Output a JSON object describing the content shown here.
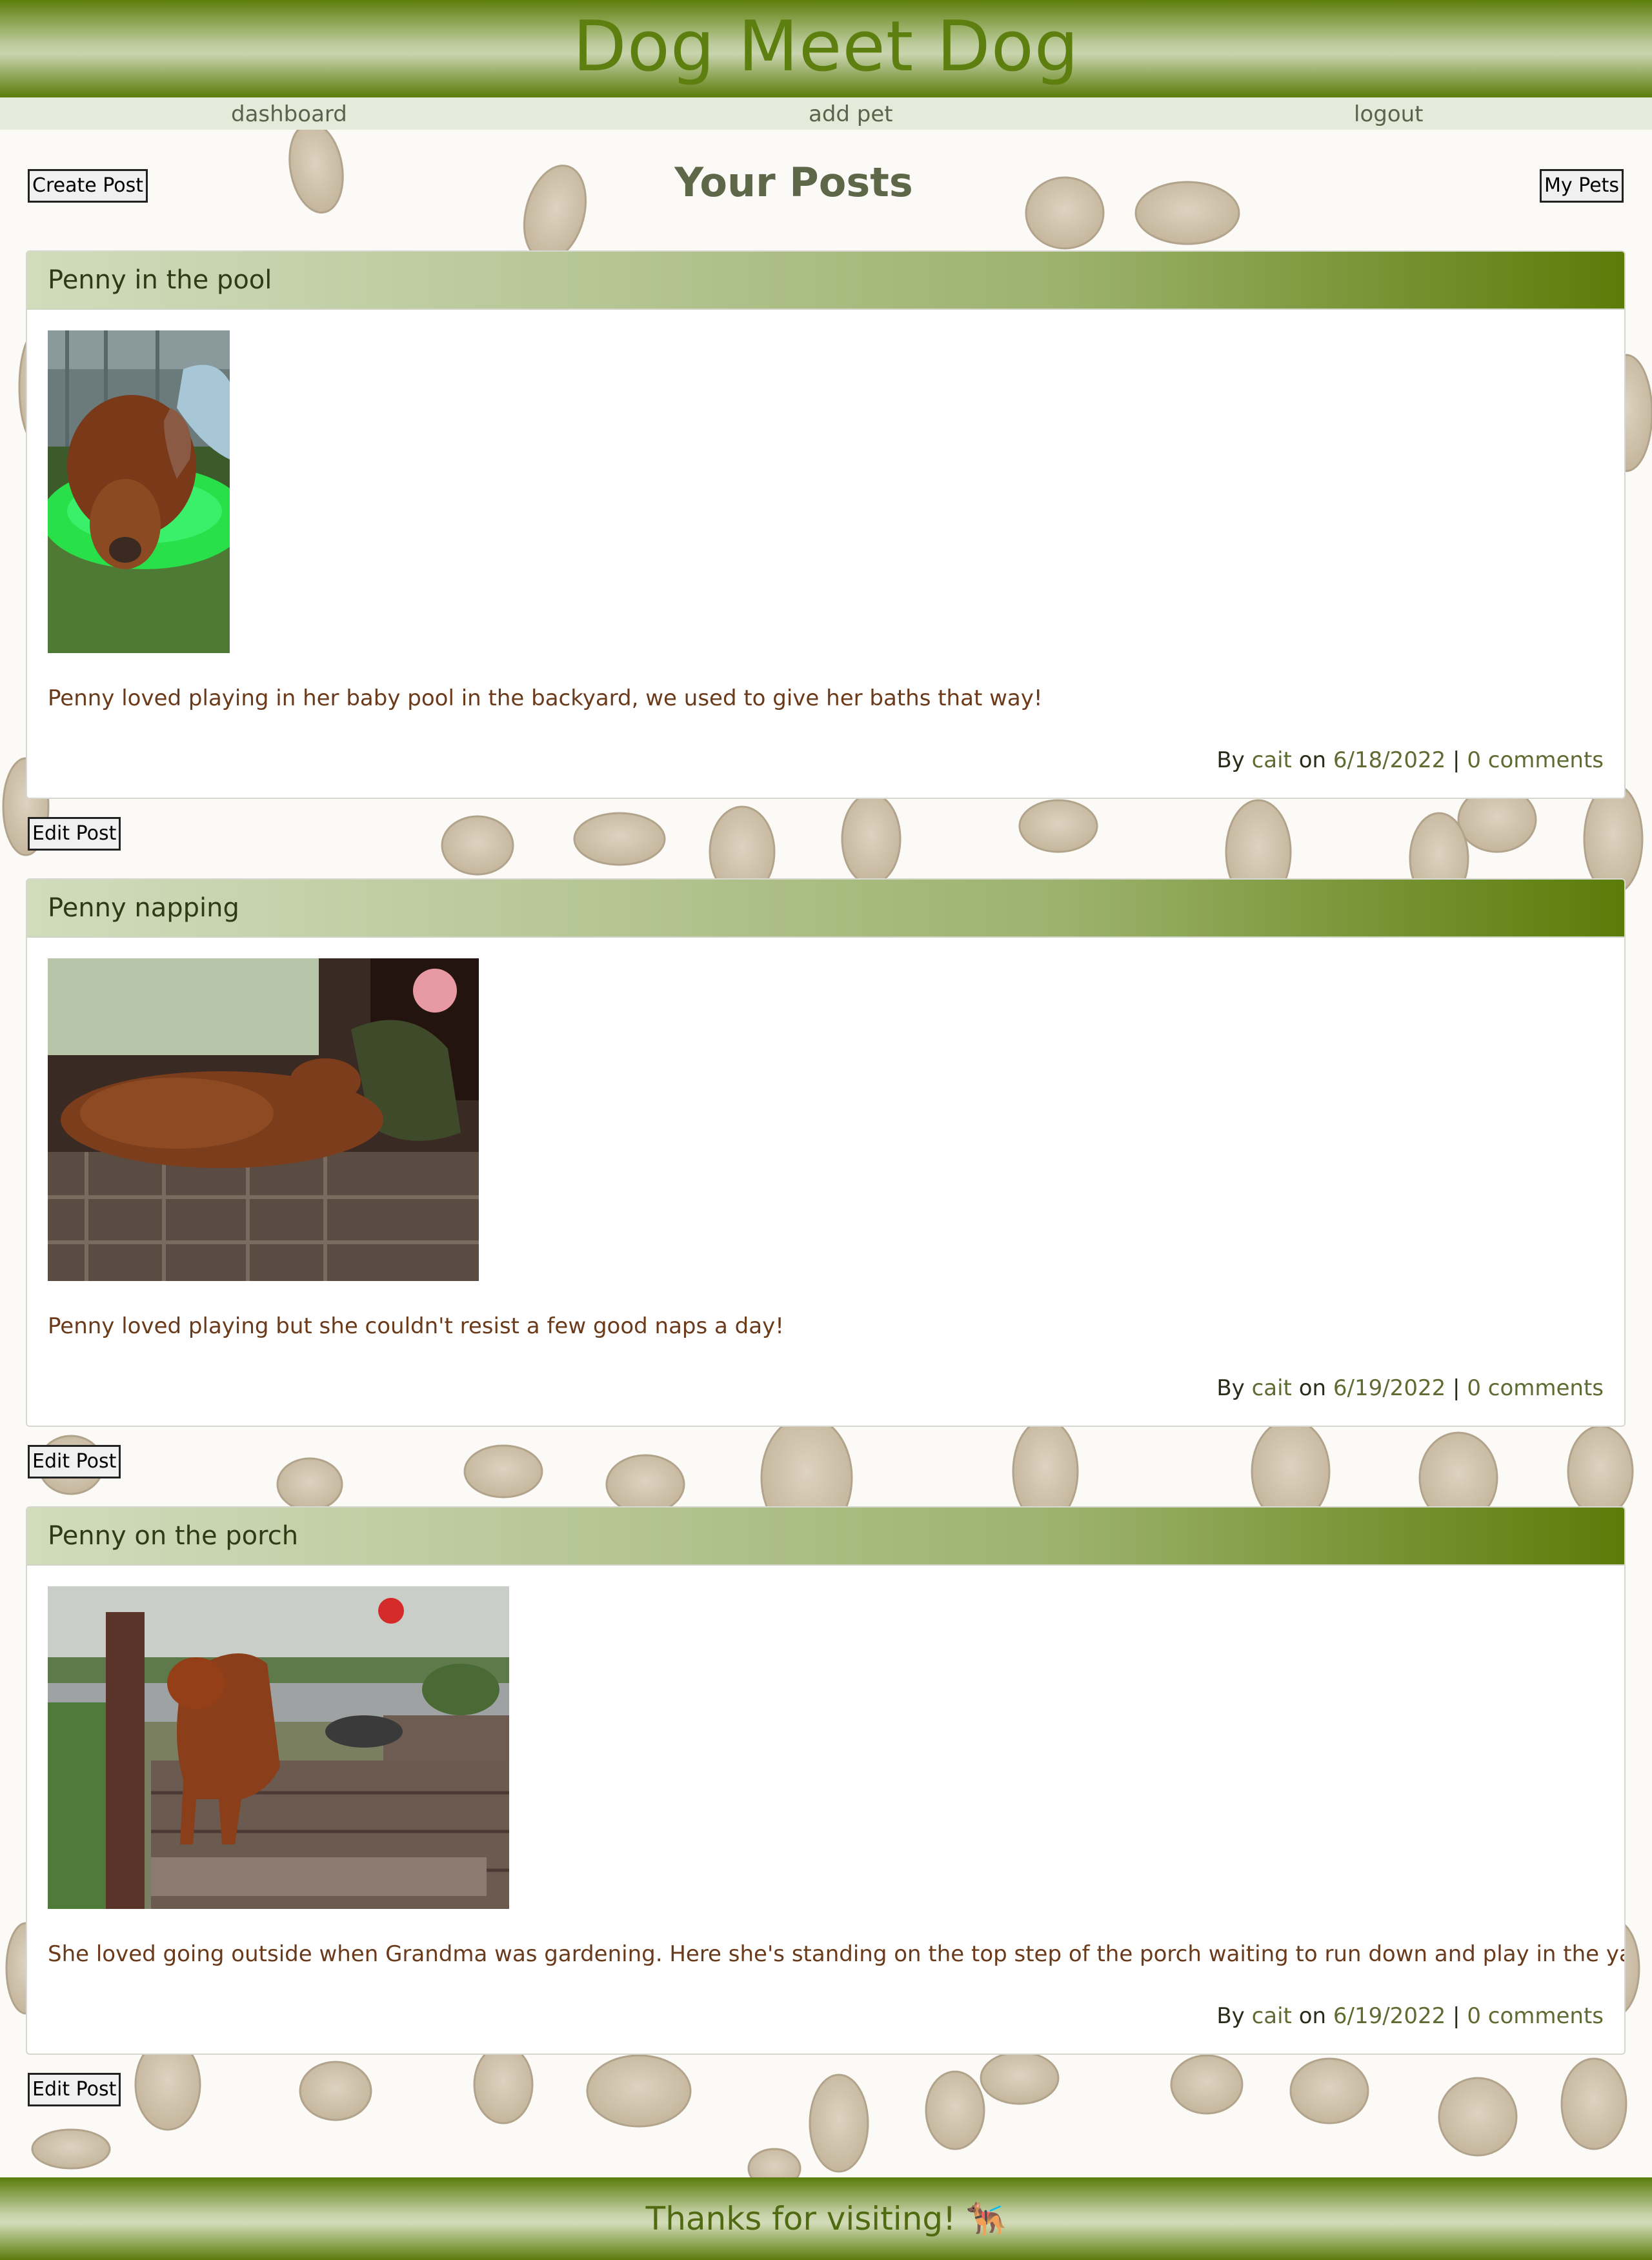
{
  "site": {
    "title": "Dog Meet Dog"
  },
  "nav": {
    "dashboard": "dashboard",
    "add_pet": "add pet",
    "logout": "logout"
  },
  "toolbar": {
    "create_post": "Create Post",
    "page_title": "Your Posts",
    "my_pets": "My Pets"
  },
  "posts": [
    {
      "title": "Penny in the pool",
      "caption": "Penny loved playing in her baby pool in the backyard, we used to give her baths that way!",
      "by": "By",
      "author": "cait",
      "on": "on",
      "date": "6/18/2022",
      "sep": "|",
      "comments": "0 comments",
      "edit_label": "Edit Post"
    },
    {
      "title": "Penny napping",
      "caption": "Penny loved playing but she couldn't resist a few good naps a day!",
      "by": "By",
      "author": "cait",
      "on": "on",
      "date": "6/19/2022",
      "sep": "|",
      "comments": "0 comments",
      "edit_label": "Edit Post"
    },
    {
      "title": "Penny on the porch",
      "caption": "She loved going outside when Grandma was gardening. Here she's standing on the top step of the porch waiting to run down and play in the yard!",
      "by": "By",
      "author": "cait",
      "on": "on",
      "date": "6/19/2022",
      "sep": "|",
      "comments": "0 comments",
      "edit_label": "Edit Post"
    }
  ],
  "footer": {
    "text": "Thanks for visiting! 🐕‍🦺"
  },
  "colors": {
    "brand_green": "#5d7f10",
    "caption_brown": "#6a3a1a",
    "nav_bg": "#e5ebdb"
  }
}
